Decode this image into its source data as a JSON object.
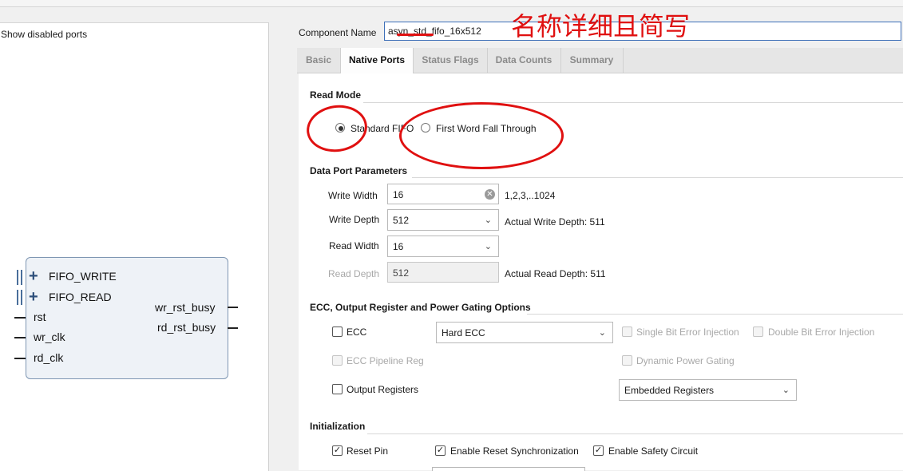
{
  "left_panel": {
    "show_disabled_ports_label": "Show disabled ports",
    "symbol": {
      "bus_ports": [
        "FIFO_WRITE",
        "FIFO_READ"
      ],
      "left_pins": [
        "rst",
        "wr_clk",
        "rd_clk"
      ],
      "right_pins": [
        "wr_rst_busy",
        "rd_rst_busy"
      ]
    }
  },
  "component": {
    "label": "Component Name",
    "value": "asyn_std_fifo_16x512"
  },
  "annotation": {
    "title": "名称详细且简写",
    "color": "#e01010"
  },
  "tabs": [
    {
      "label": "Basic",
      "active": false
    },
    {
      "label": "Native Ports",
      "active": true
    },
    {
      "label": "Status Flags",
      "active": false
    },
    {
      "label": "Data Counts",
      "active": false
    },
    {
      "label": "Summary",
      "active": false
    }
  ],
  "read_mode": {
    "title": "Read Mode",
    "options": [
      "Standard FIFO",
      "First Word Fall Through"
    ],
    "selected": "Standard FIFO"
  },
  "data_port": {
    "title": "Data Port Parameters",
    "write_width": {
      "label": "Write Width",
      "value": "16",
      "hint": "1,2,3,..1024"
    },
    "write_depth": {
      "label": "Write Depth",
      "value": "512",
      "hint": "Actual Write Depth: 511"
    },
    "read_width": {
      "label": "Read Width",
      "value": "16"
    },
    "read_depth": {
      "label": "Read Depth",
      "value": "512",
      "hint": "Actual Read Depth: 511"
    }
  },
  "ecc": {
    "title": "ECC, Output Register and Power Gating Options",
    "ecc_label": "ECC",
    "ecc_type": "Hard ECC",
    "single_bit": "Single Bit Error Injection",
    "double_bit": "Double Bit Error Injection",
    "ecc_pipeline": "ECC Pipeline Reg",
    "dynamic_power": "Dynamic Power Gating",
    "output_registers": "Output Registers",
    "output_register_type": "Embedded Registers"
  },
  "init": {
    "title": "Initialization",
    "reset_pin": "Reset Pin",
    "reset_sync": "Enable Reset Synchronization",
    "safety": "Enable Safety Circuit"
  }
}
